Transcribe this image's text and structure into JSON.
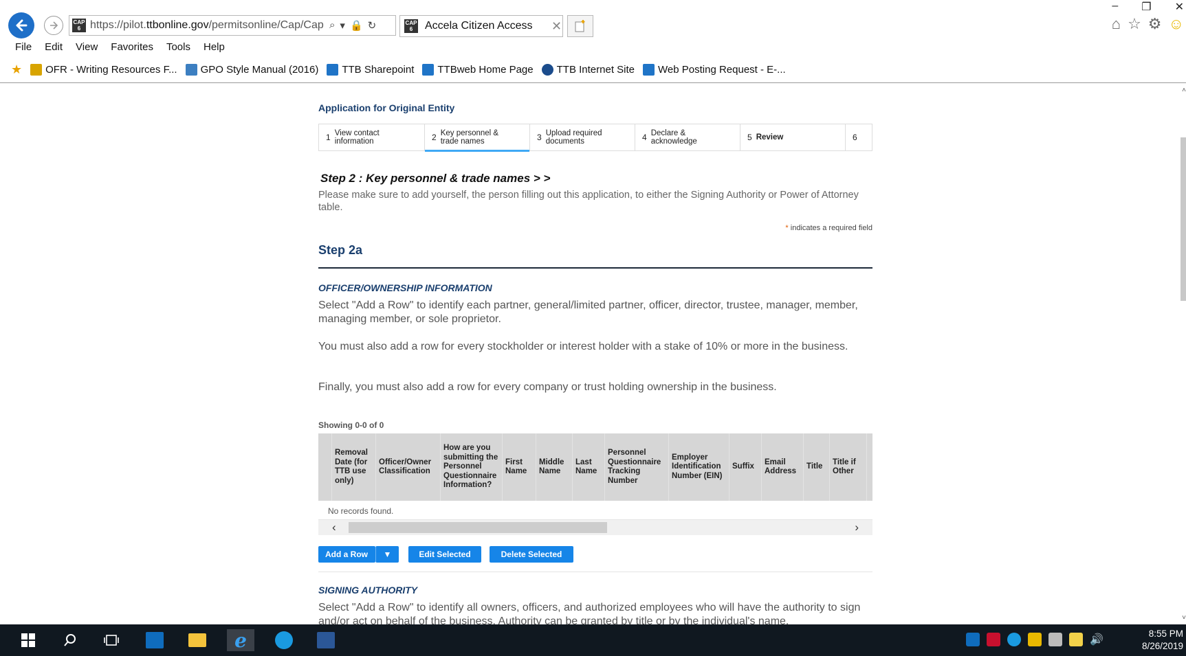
{
  "browser": {
    "url_prefix": "https://pilot.",
    "url_domain": "ttbonline.gov",
    "url_path": "/permitsonline/Cap/Cap",
    "favicon_text": "CAP 6",
    "tab_title": "Accela Citizen Access",
    "menu": [
      "File",
      "Edit",
      "View",
      "Favorites",
      "Tools",
      "Help"
    ],
    "favorites": [
      {
        "label": "OFR - Writing Resources F...",
        "icon": "page-icon",
        "color": "#d8a400"
      },
      {
        "label": "GPO Style Manual (2016)",
        "icon": "gpo-icon",
        "color": "#3c7fc1"
      },
      {
        "label": "TTB Sharepoint",
        "icon": "sharepoint-icon",
        "color": "#1f74c7"
      },
      {
        "label": "TTBweb Home Page",
        "icon": "sharepoint-icon",
        "color": "#1f74c7"
      },
      {
        "label": "TTB Internet Site",
        "icon": "ttb-seal-icon",
        "color": "#1b4c8c"
      },
      {
        "label": "Web Posting Request - E-...",
        "icon": "sharepoint-icon",
        "color": "#1f74c7"
      }
    ]
  },
  "page": {
    "app_title": "Application for Original Entity",
    "steps": [
      {
        "num": "1",
        "label_line1": "View contact",
        "label_line2": "information"
      },
      {
        "num": "2",
        "label_line1": "Key personnel &",
        "label_line2": "trade names"
      },
      {
        "num": "3",
        "label_line1": "Upload required",
        "label_line2": "documents"
      },
      {
        "num": "4",
        "label_line1": "Declare &",
        "label_line2": "acknowledge"
      },
      {
        "num": "5",
        "label_line1": "Review",
        "label_line2": ""
      },
      {
        "num": "6",
        "label_line1": "",
        "label_line2": ""
      }
    ],
    "step_heading": "Step 2 : Key personnel & trade names > >",
    "step_note": "Please make sure to add yourself, the person filling out this application, to either the Signing Authority or Power of Attorney table.",
    "required_note_star": "*",
    "required_note": " indicates a required field",
    "step2a": "Step 2a",
    "officer_section_title": "OFFICER/OWNERSHIP INFORMATION",
    "officer_para1": "Select \"Add a Row\" to identify each partner, general/limited partner, officer, director, trustee, manager, member, managing member, or sole proprietor.",
    "officer_para2": "You must also add a row for every stockholder or interest holder with a stake of 10% or more in the business.",
    "officer_para3": "Finally, you must also add a row for every company or trust holding ownership in the business.",
    "showing": "Showing 0-0 of 0",
    "table_headers": [
      "Removal Date (for TTB use only)",
      "Officer/Owner Classification",
      "How are you submitting the Personnel Questionnaire Information?",
      "First Name",
      "Middle Name",
      "Last Name",
      "Personnel Questionnaire Tracking Number",
      "Employer Identification Number (EIN)",
      "Suffix",
      "Email Address",
      "Title",
      "Title if Other"
    ],
    "no_records": "No records found.",
    "buttons": {
      "add_row": "Add a Row",
      "edit_selected": "Edit Selected",
      "delete_selected": "Delete Selected"
    },
    "signing_section_title": "SIGNING AUTHORITY",
    "signing_para": "Select \"Add a Row\" to identify all owners, officers, and authorized employees who will have the authority to sign and/or act on behalf of the business. Authority can be granted by title or by the individual's name."
  },
  "taskbar": {
    "time": "8:55 PM",
    "date": "8/26/2019"
  }
}
